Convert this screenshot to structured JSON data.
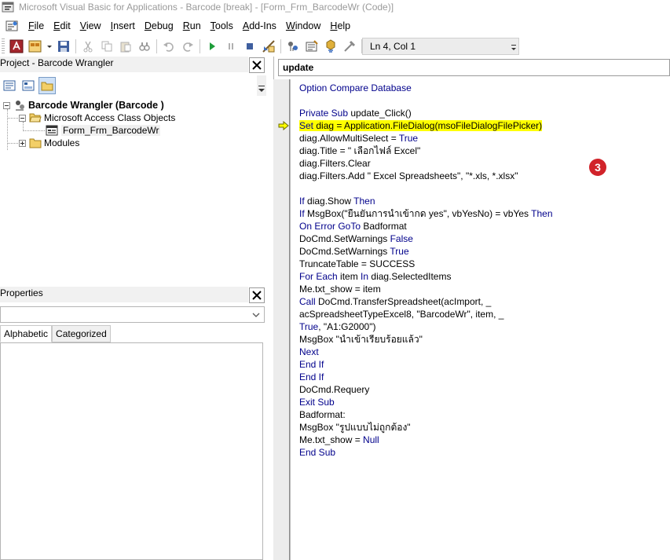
{
  "window": {
    "title": "Microsoft Visual Basic for Applications - Barcode  [break] - [Form_Frm_BarcodeWr (Code)]"
  },
  "menu": {
    "items": [
      {
        "pre": "",
        "accel": "F",
        "post": "ile"
      },
      {
        "pre": "",
        "accel": "E",
        "post": "dit"
      },
      {
        "pre": "",
        "accel": "V",
        "post": "iew"
      },
      {
        "pre": "",
        "accel": "I",
        "post": "nsert"
      },
      {
        "pre": "",
        "accel": "D",
        "post": "ebug"
      },
      {
        "pre": "",
        "accel": "R",
        "post": "un"
      },
      {
        "pre": "",
        "accel": "T",
        "post": "ools"
      },
      {
        "pre": "",
        "accel": "A",
        "post": "dd-Ins"
      },
      {
        "pre": "",
        "accel": "W",
        "post": "indow"
      },
      {
        "pre": "",
        "accel": "H",
        "post": "elp"
      }
    ]
  },
  "toolbar": {
    "position_text": "Ln 4, Col 1",
    "icons": [
      "access-view-icon",
      "insert-userform-icon",
      "save-icon",
      "cut-icon",
      "copy-icon",
      "paste-icon",
      "find-icon",
      "undo-icon",
      "redo-icon",
      "run-icon",
      "break-icon",
      "reset-icon",
      "design-mode-icon",
      "project-explorer-icon",
      "properties-window-icon",
      "object-browser-icon",
      "toolbox-icon",
      "help-icon"
    ]
  },
  "project": {
    "title": "Project - Barcode Wrangler",
    "tree": {
      "root": "Barcode Wrangler (Barcode )",
      "folder1": "Microsoft Access Class Objects",
      "item1": "Form_Frm_BarcodeWr",
      "folder2": "Modules"
    }
  },
  "properties": {
    "title": "Properties",
    "tabs": [
      "Alphabetic",
      "Categorized"
    ]
  },
  "code": {
    "procedure": "update",
    "lines": [
      [
        {
          "t": "Option Compare Database",
          "c": "kw"
        }
      ],
      [],
      [
        {
          "t": "Private Sub ",
          "c": "kw"
        },
        {
          "t": "update_Click()"
        }
      ],
      [
        {
          "t": "Set ",
          "c": "kw",
          "h": true
        },
        {
          "t": "diag = Application.FileDialog(msoFileDialogFilePicker)",
          "h": true
        }
      ],
      [
        {
          "t": "diag.AllowMultiSelect = "
        },
        {
          "t": "True",
          "c": "kw"
        }
      ],
      [
        {
          "t": "diag.Title = \" เลือกไฟล์ Excel\""
        }
      ],
      [
        {
          "t": "diag.Filters.Clear"
        }
      ],
      [
        {
          "t": "diag.Filters.Add \" Excel Spreadsheets\", \"*.xls, *.xlsx\""
        }
      ],
      [],
      [
        {
          "t": "If ",
          "c": "kw"
        },
        {
          "t": "diag.Show "
        },
        {
          "t": "Then",
          "c": "kw"
        }
      ],
      [
        {
          "t": "If ",
          "c": "kw"
        },
        {
          "t": "MsgBox(\"ยืนยันการนำเข้ากด yes\", vbYesNo) = vbYes "
        },
        {
          "t": "Then",
          "c": "kw"
        }
      ],
      [
        {
          "t": "On Error GoTo ",
          "c": "kw"
        },
        {
          "t": "Badformat"
        }
      ],
      [
        {
          "t": "DoCmd.SetWarnings "
        },
        {
          "t": "False",
          "c": "kw"
        }
      ],
      [
        {
          "t": "DoCmd.SetWarnings "
        },
        {
          "t": "True",
          "c": "kw"
        }
      ],
      [
        {
          "t": "TruncateTable = SUCCESS"
        }
      ],
      [
        {
          "t": "For Each ",
          "c": "kw"
        },
        {
          "t": "item "
        },
        {
          "t": "In ",
          "c": "kw"
        },
        {
          "t": "diag.SelectedItems"
        }
      ],
      [
        {
          "t": "Me.txt_show = item"
        }
      ],
      [
        {
          "t": "Call ",
          "c": "kw"
        },
        {
          "t": "DoCmd.TransferSpreadsheet(acImport, _"
        }
      ],
      [
        {
          "t": "acSpreadsheetTypeExcel8, \"BarcodeWr\", item, _"
        }
      ],
      [
        {
          "t": "True",
          "c": "kw"
        },
        {
          "t": ", \"A1:G2000\")"
        }
      ],
      [
        {
          "t": "MsgBox \"นำเข้าเรียบร้อยแล้ว\""
        }
      ],
      [
        {
          "t": "Next",
          "c": "kw"
        }
      ],
      [
        {
          "t": "End If",
          "c": "kw"
        }
      ],
      [
        {
          "t": "End If",
          "c": "kw"
        }
      ],
      [
        {
          "t": "DoCmd.Requery"
        }
      ],
      [
        {
          "t": "Exit Sub",
          "c": "kw"
        }
      ],
      [
        {
          "t": "Badformat:"
        }
      ],
      [
        {
          "t": "MsgBox \"รูปแบบไม่ถูกต้อง\""
        }
      ],
      [
        {
          "t": "Me.txt_show = "
        },
        {
          "t": "Null",
          "c": "kw"
        }
      ],
      [
        {
          "t": "End Sub",
          "c": "kw"
        }
      ]
    ]
  },
  "badge": {
    "label": "3",
    "color": "#d1232a"
  },
  "colors": {
    "keyword": "#00008b",
    "highlight": "#ffff00"
  }
}
